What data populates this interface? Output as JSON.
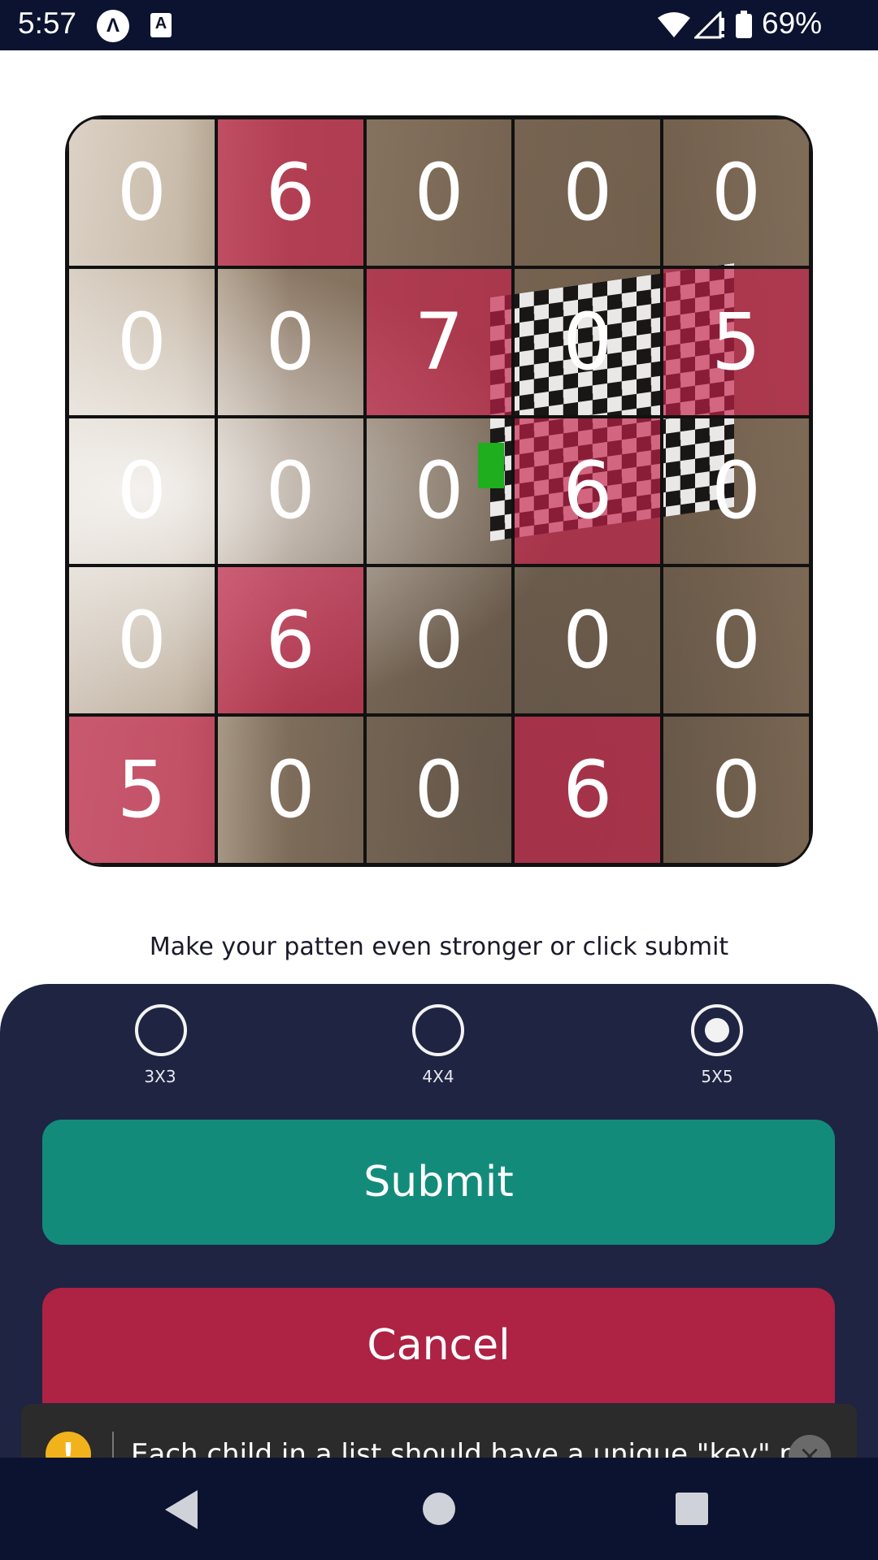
{
  "status_bar": {
    "time": "5:57",
    "battery_pct": "69%",
    "notif_a": "A"
  },
  "grid": {
    "rows": [
      [
        {
          "v": "0",
          "on": false
        },
        {
          "v": "6",
          "on": true
        },
        {
          "v": "0",
          "on": false
        },
        {
          "v": "0",
          "on": false
        },
        {
          "v": "0",
          "on": false
        }
      ],
      [
        {
          "v": "0",
          "on": false
        },
        {
          "v": "0",
          "on": false
        },
        {
          "v": "7",
          "on": true
        },
        {
          "v": "0",
          "on": false
        },
        {
          "v": "5",
          "on": true
        }
      ],
      [
        {
          "v": "0",
          "on": false
        },
        {
          "v": "0",
          "on": false
        },
        {
          "v": "0",
          "on": false
        },
        {
          "v": "6",
          "on": true
        },
        {
          "v": "0",
          "on": false
        }
      ],
      [
        {
          "v": "0",
          "on": false
        },
        {
          "v": "6",
          "on": true
        },
        {
          "v": "0",
          "on": false
        },
        {
          "v": "0",
          "on": false
        },
        {
          "v": "0",
          "on": false
        }
      ],
      [
        {
          "v": "5",
          "on": true
        },
        {
          "v": "0",
          "on": false
        },
        {
          "v": "0",
          "on": false
        },
        {
          "v": "6",
          "on": true
        },
        {
          "v": "0",
          "on": false
        }
      ]
    ],
    "highlight_color": "#c6204a"
  },
  "hint": "Make your patten even stronger or click submit",
  "sizes": {
    "options": [
      "3X3",
      "4X4",
      "5X5"
    ],
    "selected": "5X5"
  },
  "buttons": {
    "submit": "Submit",
    "cancel": "Cancel"
  },
  "toast": {
    "icon": "!",
    "text": "Each child in a list should have a unique \"key\" p",
    "close": "×"
  },
  "colors": {
    "panel": "#1e2442",
    "submit": "#138b7b",
    "cancel": "#ae2244",
    "status_bar": "#0c1330"
  }
}
